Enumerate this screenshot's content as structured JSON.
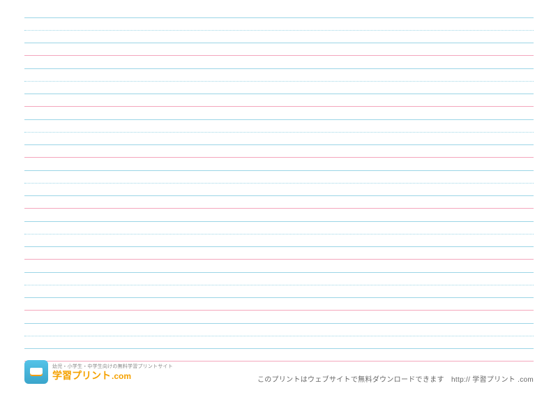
{
  "sheet": {
    "row_count": 7,
    "lines_per_row": [
      {
        "style": "solid-blue",
        "y": 0
      },
      {
        "style": "dotted-blue",
        "y": 18
      },
      {
        "style": "solid-blue",
        "y": 36
      },
      {
        "style": "solid-pink",
        "y": 54
      }
    ],
    "colors": {
      "blue": "#9bd5e6",
      "pink": "#f4a6bc"
    }
  },
  "brand": {
    "tagline": "幼児・小学生・中学生向けの無料学習プリントサイト",
    "name_main": "学習プリント",
    "name_suffix": ".com"
  },
  "footer": {
    "note": "このプリントはウェブサイトで無料ダウンロードできます　http:// 学習プリント .com"
  }
}
